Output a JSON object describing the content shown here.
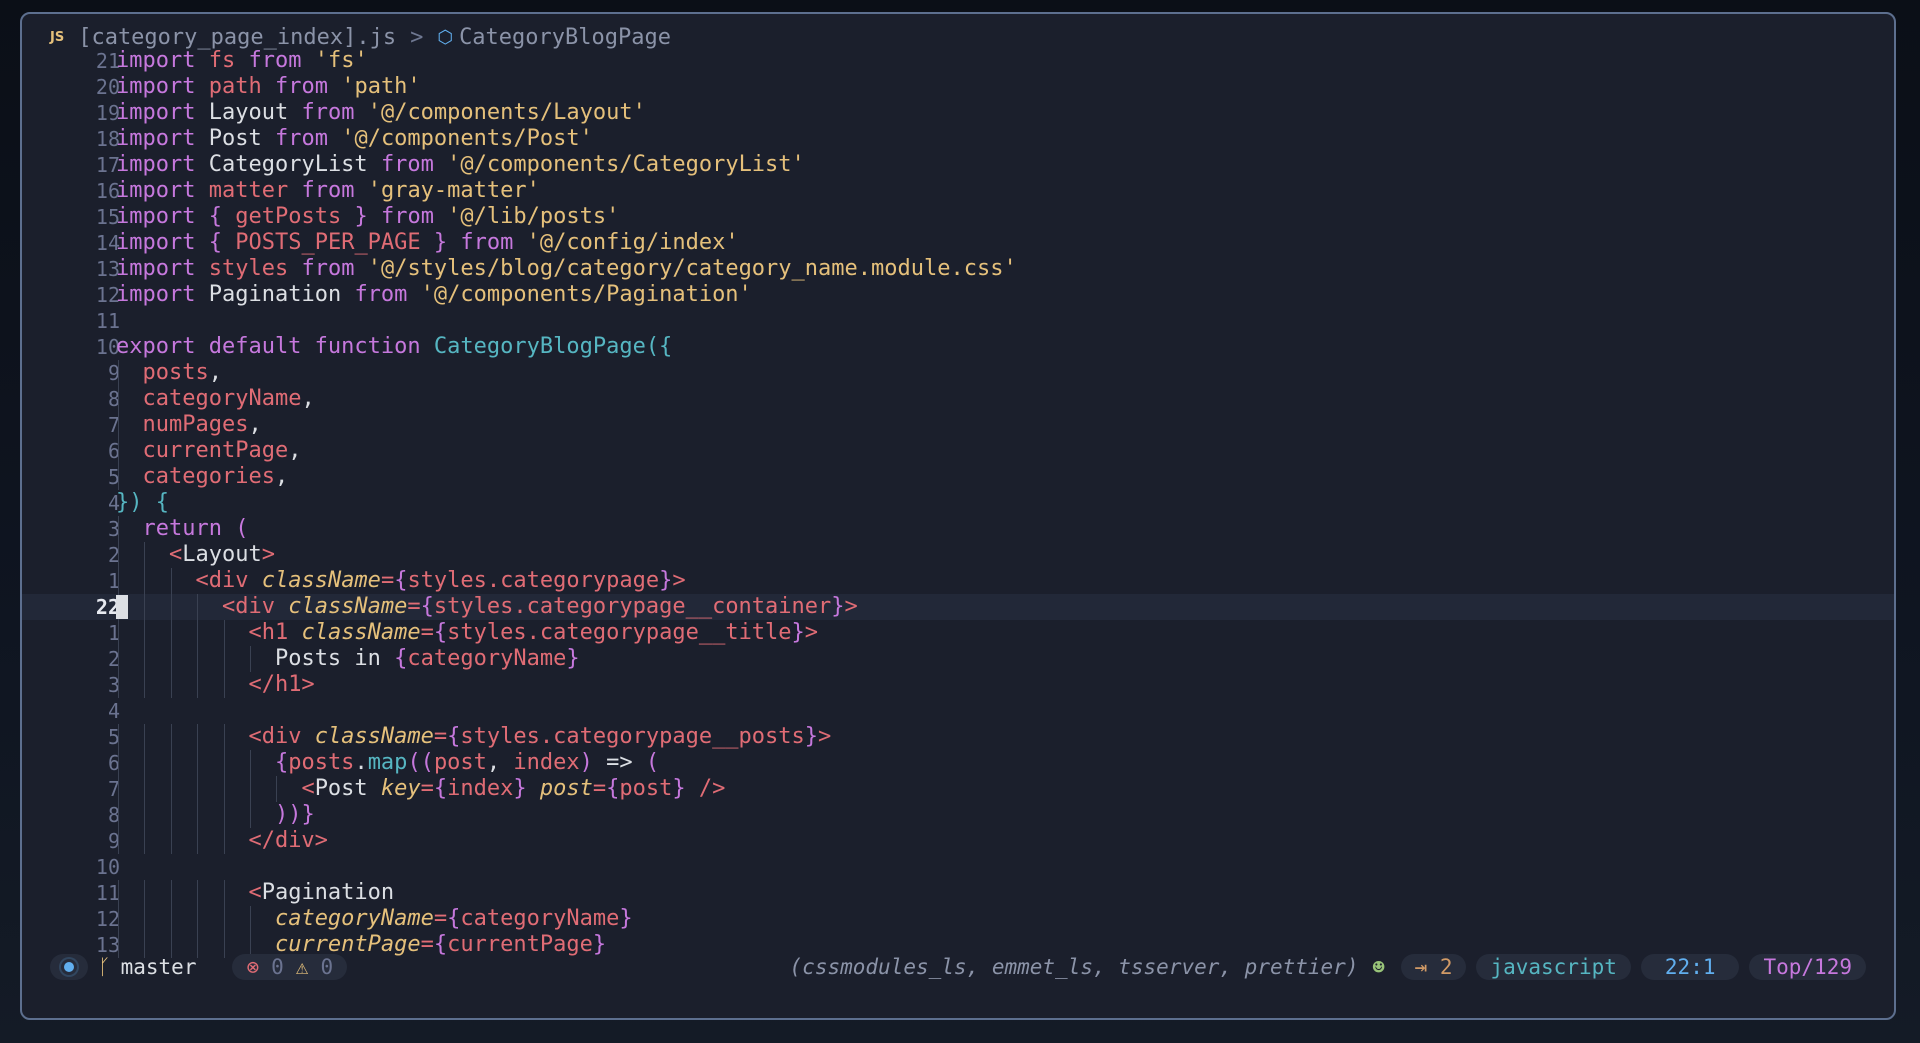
{
  "breadcrumb": {
    "file_icon": "JS",
    "file_name": "[category_page_index].js",
    "separator": ">",
    "symbol_icon": "cube-icon",
    "symbol": "CategoryBlogPage"
  },
  "code_lines": [
    {
      "num": "21",
      "html": "<span class='k'>import</span> <span class='v'>fs</span> <span class='k'>from</span> <span class='s'>'fs'</span>"
    },
    {
      "num": "20",
      "html": "<span class='k'>import</span> <span class='v'>path</span> <span class='k'>from</span> <span class='s'>'path'</span>"
    },
    {
      "num": "19",
      "html": "<span class='k'>import</span> <span class='pl'>Layout</span> <span class='k'>from</span> <span class='s'>'@/components/Layout'</span>"
    },
    {
      "num": "18",
      "html": "<span class='k'>import</span> <span class='pl'>Post</span> <span class='k'>from</span> <span class='s'>'@/components/Post'</span>"
    },
    {
      "num": "17",
      "html": "<span class='k'>import</span> <span class='pl'>CategoryList</span> <span class='k'>from</span> <span class='s'>'@/components/CategoryList'</span>"
    },
    {
      "num": "16",
      "html": "<span class='k'>import</span> <span class='v'>matter</span> <span class='k'>from</span> <span class='s'>'gray-matter'</span>"
    },
    {
      "num": "15",
      "html": "<span class='k'>import</span> <span class='p'>{</span> <span class='v'>getPosts</span> <span class='p'>}</span> <span class='k'>from</span> <span class='s'>'@/lib/posts'</span>"
    },
    {
      "num": "14",
      "html": "<span class='k'>import</span> <span class='p'>{</span> <span class='v'>POSTS_PER_PAGE</span> <span class='p'>}</span> <span class='k'>from</span> <span class='s'>'@/config/index'</span>"
    },
    {
      "num": "13",
      "html": "<span class='k'>import</span> <span class='v'>styles</span> <span class='k'>from</span> <span class='s'>'@/styles/blog/category/category_name.module.css'</span>"
    },
    {
      "num": "12",
      "html": "<span class='k'>import</span> <span class='pl'>Pagination</span> <span class='k'>from</span> <span class='s'>'@/components/Pagination'</span>"
    },
    {
      "num": "11",
      "html": ""
    },
    {
      "num": "10",
      "html": "<span class='k'>export default function</span> <span class='f'>CategoryBlogPage</span><span class='f'>({</span>"
    },
    {
      "num": "9",
      "html": "  <span class='v'>posts</span>,"
    },
    {
      "num": "8",
      "html": "  <span class='v'>categoryName</span>,"
    },
    {
      "num": "7",
      "html": "  <span class='v'>numPages</span>,"
    },
    {
      "num": "6",
      "html": "  <span class='v'>currentPage</span>,"
    },
    {
      "num": "5",
      "html": "  <span class='v'>categories</span>,"
    },
    {
      "num": "4",
      "html": "<span class='f'>}) {</span>"
    },
    {
      "num": "3",
      "html": "  <span class='k'>return</span> <span class='p'>(</span>"
    },
    {
      "num": "2",
      "html": "    <span class='t'>&lt;</span><span class='pl'>Layout</span><span class='t'>&gt;</span>"
    },
    {
      "num": "1",
      "html": "      <span class='t'>&lt;div</span> <span class='a'>className</span><span class='t'>=</span><span class='p'>{</span><span class='t'>styles.categorypage</span><span class='p'>}</span><span class='t'>&gt;</span>"
    },
    {
      "num": "22",
      "current": true,
      "html": "        <span class='t'>&lt;div</span> <span class='a'>className</span><span class='t'>=</span><span class='p'>{</span><span class='t'>styles.categorypage__container</span><span class='p'>}</span><span class='t'>&gt;</span>"
    },
    {
      "num": "1",
      "html": "          <span class='t'>&lt;h1</span> <span class='a'>className</span><span class='t'>=</span><span class='p'>{</span><span class='t'>styles.categorypage__title</span><span class='p'>}</span><span class='t'>&gt;</span>"
    },
    {
      "num": "2",
      "html": "            <span class='pl'>Posts in</span> <span class='p'>{</span><span class='v'>categoryName</span><span class='p'>}</span>"
    },
    {
      "num": "3",
      "html": "          <span class='t'>&lt;/h1&gt;</span>"
    },
    {
      "num": "4",
      "html": ""
    },
    {
      "num": "5",
      "html": "          <span class='t'>&lt;div</span> <span class='a'>className</span><span class='t'>=</span><span class='p'>{</span><span class='t'>styles.categorypage__posts</span><span class='p'>}</span><span class='t'>&gt;</span>"
    },
    {
      "num": "6",
      "html": "            <span class='p'>{</span><span class='v'>posts</span>.<span class='f'>map</span><span class='p'>((</span><span class='v'>post</span>, <span class='v'>index</span><span class='p'>)</span> <span class='pl'>=&gt;</span> <span class='p'>(</span>"
    },
    {
      "num": "7",
      "html": "              <span class='t'>&lt;</span><span class='pl'>Post</span> <span class='a'>key</span><span class='t'>=</span><span class='p'>{</span><span class='v'>index</span><span class='p'>}</span> <span class='a'>post</span><span class='t'>=</span><span class='p'>{</span><span class='v'>post</span><span class='p'>}</span> <span class='t'>/&gt;</span>"
    },
    {
      "num": "8",
      "html": "            <span class='p'>))}</span>"
    },
    {
      "num": "9",
      "html": "          <span class='t'>&lt;/div&gt;</span>"
    },
    {
      "num": "10",
      "html": ""
    },
    {
      "num": "11",
      "html": "          <span class='t'>&lt;</span><span class='pl'>Pagination</span>"
    },
    {
      "num": "12",
      "html": "            <span class='a'>categoryName</span><span class='t'>=</span><span class='p'>{</span><span class='v'>categoryName</span><span class='p'>}</span>"
    },
    {
      "num": "13",
      "html": "            <span class='a'>currentPage</span><span class='t'>=</span><span class='p'>{</span><span class='v'>currentPage</span><span class='p'>}</span>"
    }
  ],
  "status": {
    "branch": "master",
    "errors": "0",
    "warnings": "0",
    "lsp_clients": "(cssmodules_ls, emmet_ls, tsserver, prettier)",
    "copilot_icon": "copilot-icon",
    "indent": "⇥ 2",
    "language": "javascript",
    "position": "22:1",
    "scroll": "Top/129"
  }
}
